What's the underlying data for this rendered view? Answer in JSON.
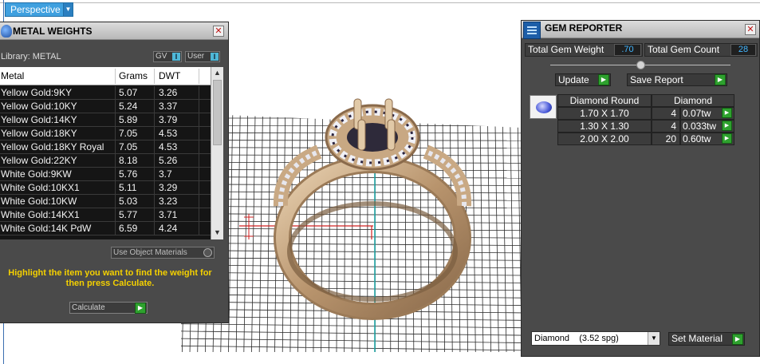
{
  "viewport": {
    "view_label": "Perspective"
  },
  "metal_weights": {
    "title": "METAL WEIGHTS",
    "library_label": "Library: METAL",
    "gv_label": "GV",
    "user_label": "User",
    "toggle_mark": "I",
    "columns": [
      "Metal",
      "Grams",
      "DWT"
    ],
    "rows": [
      {
        "metal": "Yellow Gold:9KY",
        "grams": "5.07",
        "dwt": "3.26"
      },
      {
        "metal": "Yellow Gold:10KY",
        "grams": "5.24",
        "dwt": "3.37"
      },
      {
        "metal": "Yellow Gold:14KY",
        "grams": "5.89",
        "dwt": "3.79"
      },
      {
        "metal": "Yellow Gold:18KY",
        "grams": "7.05",
        "dwt": "4.53"
      },
      {
        "metal": "Yellow Gold:18KY Royal",
        "grams": "7.05",
        "dwt": "4.53"
      },
      {
        "metal": "Yellow Gold:22KY",
        "grams": "8.18",
        "dwt": "5.26"
      },
      {
        "metal": "White Gold:9KW",
        "grams": "5.76",
        "dwt": "3.7"
      },
      {
        "metal": "White Gold:10KX1",
        "grams": "5.11",
        "dwt": "3.29"
      },
      {
        "metal": "White Gold:10KW",
        "grams": "5.03",
        "dwt": "3.23"
      },
      {
        "metal": "White Gold:14KX1",
        "grams": "5.77",
        "dwt": "3.71"
      },
      {
        "metal": "White Gold:14K PdW",
        "grams": "6.59",
        "dwt": "4.24"
      }
    ],
    "use_object_materials": "Use Object Materials",
    "hint_text": "Highlight the item you want to find the weight for then press Calculate.",
    "calculate_label": "Calculate"
  },
  "gem_reporter": {
    "title": "GEM REPORTER",
    "total_gem_weight_label": "Total Gem Weight",
    "total_gem_weight_value": ".70",
    "total_gem_count_label": "Total Gem Count",
    "total_gem_count_value": "28",
    "update_label": "Update",
    "save_report_label": "Save Report",
    "table_header": {
      "shape": "Diamond Round",
      "material": "Diamond"
    },
    "rows": [
      {
        "size": "1.70 X 1.70",
        "count": "4",
        "weight": "0.07tw"
      },
      {
        "size": "1.30 X 1.30",
        "count": "4",
        "weight": "0.033tw"
      },
      {
        "size": "2.00 X 2.00",
        "count": "20",
        "weight": "0.60tw"
      }
    ],
    "material_select": "Diamond    (3.52 spg)",
    "set_material_label": "Set Material"
  },
  "icons": {
    "close": "✕",
    "play": "▶",
    "dropdown": "▼",
    "scroll_up": "▲",
    "scroll_down": "▼"
  },
  "colors": {
    "panel_bg": "#4a4a4a",
    "accent_blue": "#3fa0df",
    "value_blue": "#43b6ff",
    "hint_yellow": "#f4d000",
    "go_green": "#2ea12e"
  }
}
